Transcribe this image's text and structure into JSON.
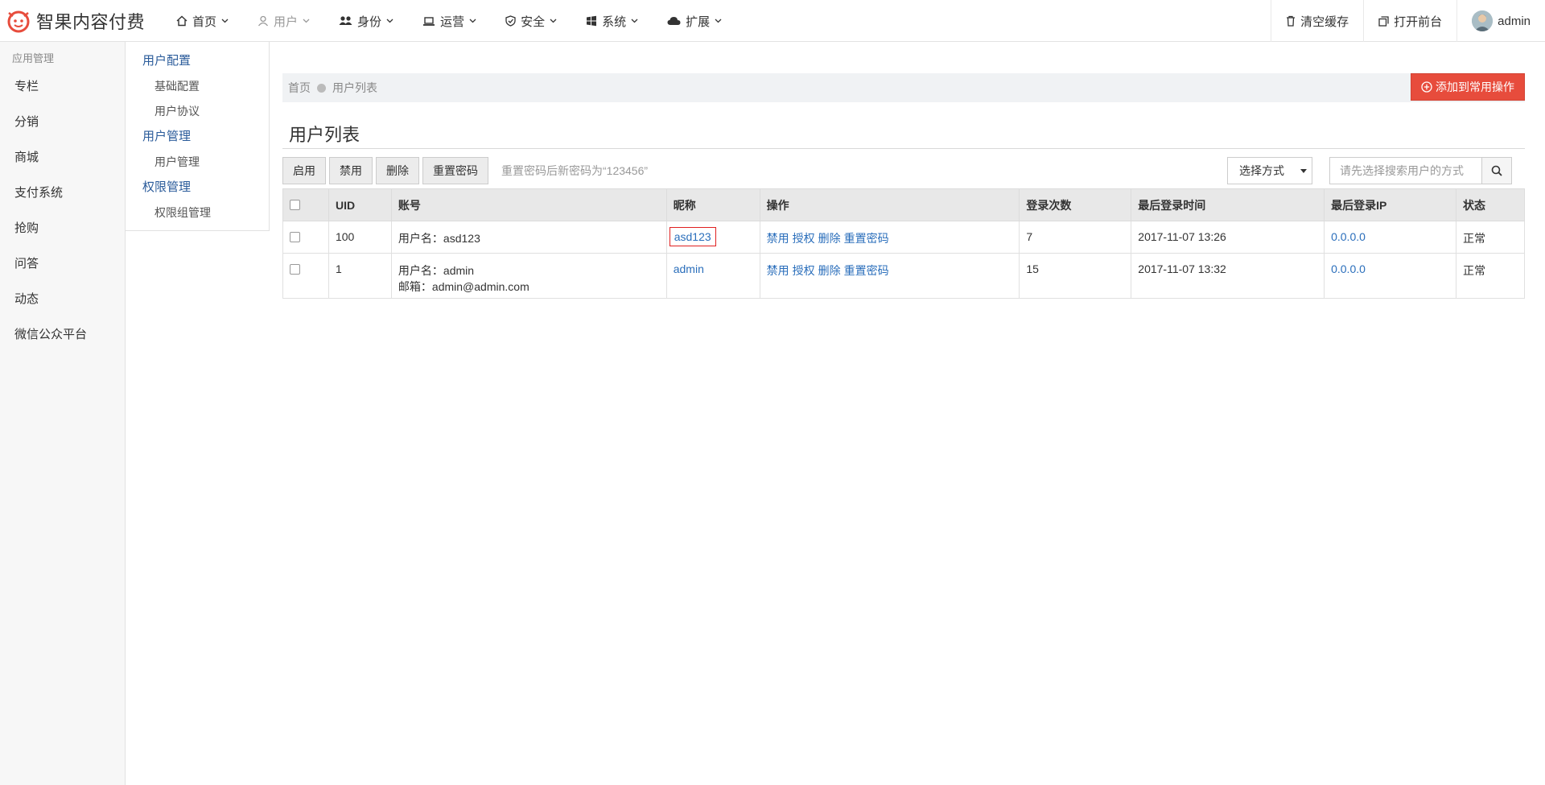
{
  "brand": {
    "name": "智果内容付费",
    "accent": "#e74c3c"
  },
  "nav": [
    {
      "label": "首页",
      "icon": "home-icon"
    },
    {
      "label": "用户",
      "icon": "user-icon",
      "muted": true
    },
    {
      "label": "身份",
      "icon": "users-icon"
    },
    {
      "label": "运营",
      "icon": "laptop-icon"
    },
    {
      "label": "安全",
      "icon": "shield-icon"
    },
    {
      "label": "系统",
      "icon": "windows-icon"
    },
    {
      "label": "扩展",
      "icon": "cloud-icon"
    }
  ],
  "top_right": {
    "clear_cache": "清空缓存",
    "open_frontend": "打开前台",
    "username": "admin"
  },
  "sidebar": {
    "title": "应用管理",
    "items": [
      "专栏",
      "分销",
      "商城",
      "支付系统",
      "抢购",
      "问答",
      "动态",
      "微信公众平台"
    ]
  },
  "submenu": {
    "groups": [
      {
        "label": "用户配置",
        "items": [
          "基础配置",
          "用户协议"
        ]
      },
      {
        "label": "用户管理",
        "items": [
          "用户管理"
        ]
      },
      {
        "label": "权限管理",
        "items": [
          "权限组管理"
        ]
      }
    ]
  },
  "breadcrumb": {
    "home": "首页",
    "current": "用户列表"
  },
  "add_button": "添加到常用操作",
  "page_title": "用户列表",
  "toolbar": {
    "enable": "启用",
    "disable": "禁用",
    "delete": "删除",
    "reset_password": "重置密码",
    "hint": "重置密码后新密码为“123456”"
  },
  "search": {
    "select_label": "选择方式",
    "placeholder": "请先选择搜索用户的方式"
  },
  "table": {
    "headers": [
      "UID",
      "账号",
      "昵称",
      "操作",
      "登录次数",
      "最后登录时间",
      "最后登录IP",
      "状态"
    ],
    "ops": [
      "禁用",
      "授权",
      "删除",
      "重置密码"
    ],
    "rows": [
      {
        "uid": "100",
        "account": [
          "用户名：asd123"
        ],
        "nickname": "asd123",
        "logins": "7",
        "last_login": "2017-11-07 13:26",
        "ip": "0.0.0.0",
        "status": "正常"
      },
      {
        "uid": "1",
        "account": [
          "用户名：admin",
          "邮箱：admin@admin.com"
        ],
        "nickname": "admin",
        "logins": "15",
        "last_login": "2017-11-07 13:32",
        "ip": "0.0.0.0",
        "status": "正常"
      }
    ]
  }
}
